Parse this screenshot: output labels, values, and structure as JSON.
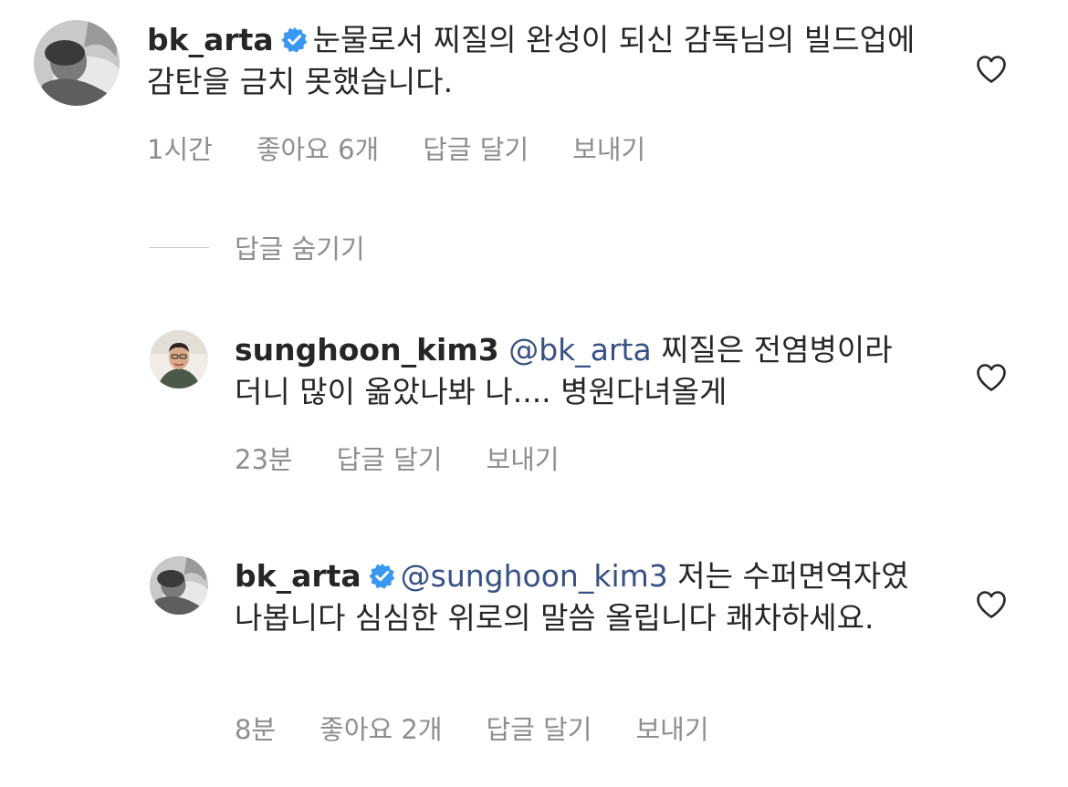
{
  "comments": [
    {
      "username": "bk_arta",
      "verified": true,
      "mention": "",
      "text": "눈물로서 찌질의 완성이 되신 감독님의 빌드업에 감탄을 금치 못했습니다.",
      "time": "1시간",
      "likes": "좋아요 6개",
      "reply_label": "답글 달기",
      "send_label": "보내기",
      "avatar_icon": "profile-photo"
    },
    {
      "username": "sunghoon_kim3",
      "verified": false,
      "mention": "@bk_arta",
      "text": "찌질은 전염병이라더니 많이 옮았나봐 나.... 병원다녀올게",
      "time": "23분",
      "likes": "",
      "reply_label": "답글 달기",
      "send_label": "보내기",
      "avatar_icon": "profile-photo"
    },
    {
      "username": "bk_arta",
      "verified": true,
      "mention": "@sunghoon_kim3",
      "text": "저는 수퍼면역자였나봅니다 심심한 위로의 말씀 올립니다 쾌차하세요.",
      "time": "8분",
      "likes": "좋아요 2개",
      "reply_label": "답글 달기",
      "send_label": "보내기",
      "avatar_icon": "profile-photo"
    }
  ],
  "hide_replies_label": "답글 숨기기",
  "colors": {
    "text": "#262626",
    "meta": "#8e8e8e",
    "mention": "#385185",
    "verified": "#3897f0"
  },
  "icons": {
    "like": "heart-outline-icon",
    "verified": "verified-badge-icon"
  }
}
